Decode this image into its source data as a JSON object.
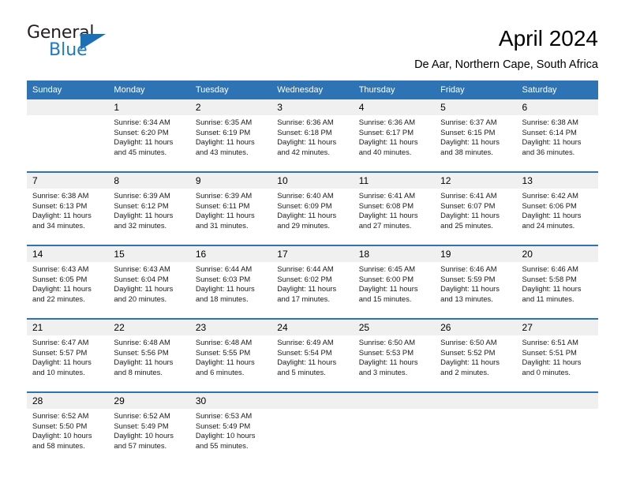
{
  "brand": {
    "name_part1": "General",
    "name_part2": "Blue",
    "logo_icon": "triangle-flag-icon"
  },
  "header": {
    "title": "April 2024",
    "subtitle": "De Aar, Northern Cape, South Africa"
  },
  "calendar": {
    "weekday_headers": [
      "Sunday",
      "Monday",
      "Tuesday",
      "Wednesday",
      "Thursday",
      "Friday",
      "Saturday"
    ],
    "colors": {
      "header_blue": "#2e74b5",
      "daynum_gray": "#f0f0f0",
      "brand_blue": "#1f7ac1",
      "text": "#000000"
    },
    "weeks": [
      [
        {
          "day": "",
          "lines": []
        },
        {
          "day": "1",
          "lines": [
            "Sunrise: 6:34 AM",
            "Sunset: 6:20 PM",
            "Daylight: 11 hours",
            "and 45 minutes."
          ]
        },
        {
          "day": "2",
          "lines": [
            "Sunrise: 6:35 AM",
            "Sunset: 6:19 PM",
            "Daylight: 11 hours",
            "and 43 minutes."
          ]
        },
        {
          "day": "3",
          "lines": [
            "Sunrise: 6:36 AM",
            "Sunset: 6:18 PM",
            "Daylight: 11 hours",
            "and 42 minutes."
          ]
        },
        {
          "day": "4",
          "lines": [
            "Sunrise: 6:36 AM",
            "Sunset: 6:17 PM",
            "Daylight: 11 hours",
            "and 40 minutes."
          ]
        },
        {
          "day": "5",
          "lines": [
            "Sunrise: 6:37 AM",
            "Sunset: 6:15 PM",
            "Daylight: 11 hours",
            "and 38 minutes."
          ]
        },
        {
          "day": "6",
          "lines": [
            "Sunrise: 6:38 AM",
            "Sunset: 6:14 PM",
            "Daylight: 11 hours",
            "and 36 minutes."
          ]
        }
      ],
      [
        {
          "day": "7",
          "lines": [
            "Sunrise: 6:38 AM",
            "Sunset: 6:13 PM",
            "Daylight: 11 hours",
            "and 34 minutes."
          ]
        },
        {
          "day": "8",
          "lines": [
            "Sunrise: 6:39 AM",
            "Sunset: 6:12 PM",
            "Daylight: 11 hours",
            "and 32 minutes."
          ]
        },
        {
          "day": "9",
          "lines": [
            "Sunrise: 6:39 AM",
            "Sunset: 6:11 PM",
            "Daylight: 11 hours",
            "and 31 minutes."
          ]
        },
        {
          "day": "10",
          "lines": [
            "Sunrise: 6:40 AM",
            "Sunset: 6:09 PM",
            "Daylight: 11 hours",
            "and 29 minutes."
          ]
        },
        {
          "day": "11",
          "lines": [
            "Sunrise: 6:41 AM",
            "Sunset: 6:08 PM",
            "Daylight: 11 hours",
            "and 27 minutes."
          ]
        },
        {
          "day": "12",
          "lines": [
            "Sunrise: 6:41 AM",
            "Sunset: 6:07 PM",
            "Daylight: 11 hours",
            "and 25 minutes."
          ]
        },
        {
          "day": "13",
          "lines": [
            "Sunrise: 6:42 AM",
            "Sunset: 6:06 PM",
            "Daylight: 11 hours",
            "and 24 minutes."
          ]
        }
      ],
      [
        {
          "day": "14",
          "lines": [
            "Sunrise: 6:43 AM",
            "Sunset: 6:05 PM",
            "Daylight: 11 hours",
            "and 22 minutes."
          ]
        },
        {
          "day": "15",
          "lines": [
            "Sunrise: 6:43 AM",
            "Sunset: 6:04 PM",
            "Daylight: 11 hours",
            "and 20 minutes."
          ]
        },
        {
          "day": "16",
          "lines": [
            "Sunrise: 6:44 AM",
            "Sunset: 6:03 PM",
            "Daylight: 11 hours",
            "and 18 minutes."
          ]
        },
        {
          "day": "17",
          "lines": [
            "Sunrise: 6:44 AM",
            "Sunset: 6:02 PM",
            "Daylight: 11 hours",
            "and 17 minutes."
          ]
        },
        {
          "day": "18",
          "lines": [
            "Sunrise: 6:45 AM",
            "Sunset: 6:00 PM",
            "Daylight: 11 hours",
            "and 15 minutes."
          ]
        },
        {
          "day": "19",
          "lines": [
            "Sunrise: 6:46 AM",
            "Sunset: 5:59 PM",
            "Daylight: 11 hours",
            "and 13 minutes."
          ]
        },
        {
          "day": "20",
          "lines": [
            "Sunrise: 6:46 AM",
            "Sunset: 5:58 PM",
            "Daylight: 11 hours",
            "and 11 minutes."
          ]
        }
      ],
      [
        {
          "day": "21",
          "lines": [
            "Sunrise: 6:47 AM",
            "Sunset: 5:57 PM",
            "Daylight: 11 hours",
            "and 10 minutes."
          ]
        },
        {
          "day": "22",
          "lines": [
            "Sunrise: 6:48 AM",
            "Sunset: 5:56 PM",
            "Daylight: 11 hours",
            "and 8 minutes."
          ]
        },
        {
          "day": "23",
          "lines": [
            "Sunrise: 6:48 AM",
            "Sunset: 5:55 PM",
            "Daylight: 11 hours",
            "and 6 minutes."
          ]
        },
        {
          "day": "24",
          "lines": [
            "Sunrise: 6:49 AM",
            "Sunset: 5:54 PM",
            "Daylight: 11 hours",
            "and 5 minutes."
          ]
        },
        {
          "day": "25",
          "lines": [
            "Sunrise: 6:50 AM",
            "Sunset: 5:53 PM",
            "Daylight: 11 hours",
            "and 3 minutes."
          ]
        },
        {
          "day": "26",
          "lines": [
            "Sunrise: 6:50 AM",
            "Sunset: 5:52 PM",
            "Daylight: 11 hours",
            "and 2 minutes."
          ]
        },
        {
          "day": "27",
          "lines": [
            "Sunrise: 6:51 AM",
            "Sunset: 5:51 PM",
            "Daylight: 11 hours",
            "and 0 minutes."
          ]
        }
      ],
      [
        {
          "day": "28",
          "lines": [
            "Sunrise: 6:52 AM",
            "Sunset: 5:50 PM",
            "Daylight: 10 hours",
            "and 58 minutes."
          ]
        },
        {
          "day": "29",
          "lines": [
            "Sunrise: 6:52 AM",
            "Sunset: 5:49 PM",
            "Daylight: 10 hours",
            "and 57 minutes."
          ]
        },
        {
          "day": "30",
          "lines": [
            "Sunrise: 6:53 AM",
            "Sunset: 5:49 PM",
            "Daylight: 10 hours",
            "and 55 minutes."
          ]
        },
        {
          "day": "",
          "lines": []
        },
        {
          "day": "",
          "lines": []
        },
        {
          "day": "",
          "lines": []
        },
        {
          "day": "",
          "lines": []
        }
      ]
    ]
  }
}
